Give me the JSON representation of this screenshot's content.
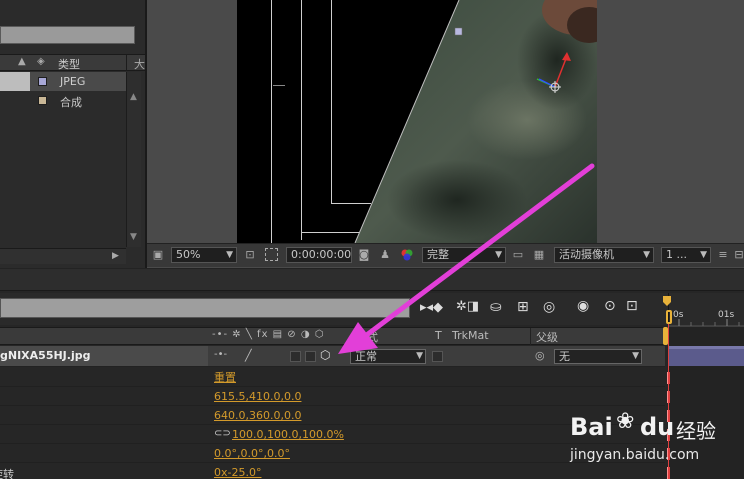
{
  "project_panel": {
    "col_type_header": "类型",
    "col_next_partial": "大",
    "items": [
      {
        "type": "JPEG",
        "swatch_color": "#a7a7d6"
      },
      {
        "type": "合成",
        "swatch_color": "#c9b796"
      }
    ]
  },
  "viewer_toolbar": {
    "zoom": "50%",
    "timecode": "0:00:00:00",
    "resolution": "完整",
    "camera": "活动摄像机",
    "views": "1 ..."
  },
  "timeline": {
    "layer_name": "gNIXA55HJ.jpg",
    "col_mode_partial": "模式",
    "col_t": "T",
    "col_trkmat": "TrkMat",
    "col_parent": "父级",
    "mode_value": "正常",
    "parent_value": "无",
    "ruler_0": "0s",
    "ruler_1": "01s",
    "properties": [
      {
        "value": "重置"
      },
      {
        "value": "615.5,410.0,0.0"
      },
      {
        "value": "640.0,360.0,0.0"
      },
      {
        "value": "100.0,100.0,100.0%"
      },
      {
        "value": "0.0°,0.0°,0.0°"
      },
      {
        "label_partial": "旋转",
        "value": "0x-25.0°"
      }
    ]
  },
  "watermark": {
    "brand": "Bai",
    "brand2": "du",
    "cn": "经验",
    "url": "jingyan.baidu.com"
  },
  "colors": {
    "accent_orange": "#d39a2b",
    "annotation_arrow": "#e23fd8",
    "playhead": "#e8b23a"
  }
}
